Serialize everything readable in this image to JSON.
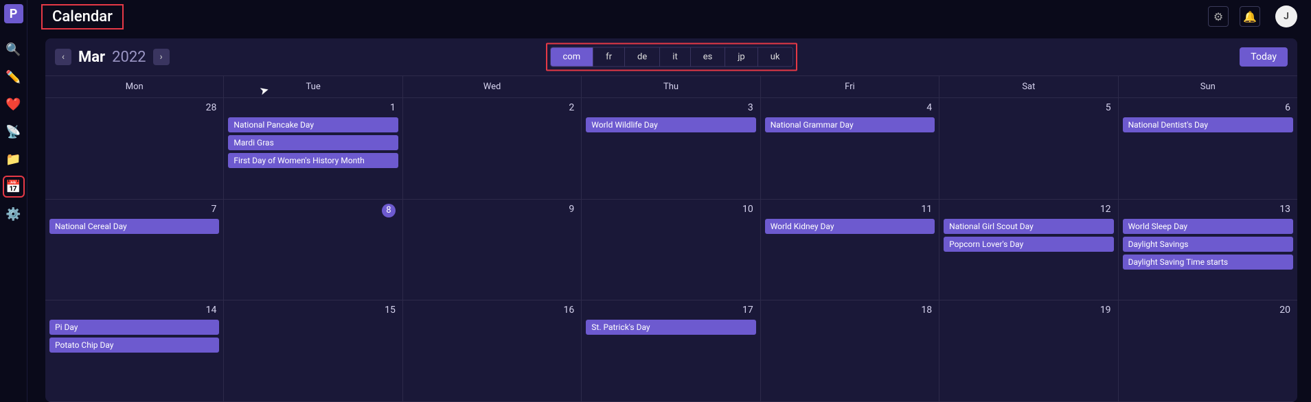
{
  "app": {
    "logo_letter": "P",
    "avatar_letter": "J"
  },
  "page": {
    "title": "Calendar"
  },
  "sidebar": {
    "items": [
      {
        "name": "search-icon",
        "glyph": "🔍"
      },
      {
        "name": "pencil-icon",
        "glyph": "✏️"
      },
      {
        "name": "heart-icon",
        "glyph": "❤️"
      },
      {
        "name": "satellite-icon",
        "glyph": "📡"
      },
      {
        "name": "folder-icon",
        "glyph": "📁"
      },
      {
        "name": "calendar-icon",
        "glyph": "📅",
        "active": true
      },
      {
        "name": "settings-icon",
        "glyph": "⚙️"
      }
    ]
  },
  "calendar": {
    "month": "Mar",
    "year": "2022",
    "today_label": "Today",
    "locales": [
      {
        "code": "com",
        "active": true
      },
      {
        "code": "fr"
      },
      {
        "code": "de"
      },
      {
        "code": "it"
      },
      {
        "code": "es"
      },
      {
        "code": "jp"
      },
      {
        "code": "uk"
      }
    ],
    "weekdays": [
      "Mon",
      "Tue",
      "Wed",
      "Thu",
      "Fri",
      "Sat",
      "Sun"
    ],
    "cells": [
      {
        "date": "28",
        "events": []
      },
      {
        "date": "1",
        "events": [
          "National Pancake Day",
          "Mardi Gras",
          "First Day of Women's History Month"
        ]
      },
      {
        "date": "2",
        "events": []
      },
      {
        "date": "3",
        "events": [
          "World Wildlife Day"
        ]
      },
      {
        "date": "4",
        "events": [
          "National Grammar Day"
        ]
      },
      {
        "date": "5",
        "events": []
      },
      {
        "date": "6",
        "events": [
          "National Dentist's Day"
        ]
      },
      {
        "date": "7",
        "events": [
          "National Cereal Day"
        ]
      },
      {
        "date": "8",
        "badge": true,
        "events": []
      },
      {
        "date": "9",
        "events": []
      },
      {
        "date": "10",
        "events": []
      },
      {
        "date": "11",
        "events": [
          "World Kidney Day"
        ]
      },
      {
        "date": "12",
        "events": [
          "National Girl Scout Day",
          "Popcorn Lover's Day"
        ]
      },
      {
        "date": "13",
        "events": [
          "World Sleep Day",
          "Daylight Savings",
          "Daylight Saving Time starts"
        ]
      },
      {
        "date": "14",
        "events": [
          "Pi Day",
          "Potato Chip Day"
        ]
      },
      {
        "date": "15",
        "events": []
      },
      {
        "date": "16",
        "events": []
      },
      {
        "date": "17",
        "events": [
          "St. Patrick's Day"
        ]
      },
      {
        "date": "18",
        "events": []
      },
      {
        "date": "19",
        "events": []
      },
      {
        "date": "20",
        "events": []
      }
    ]
  }
}
